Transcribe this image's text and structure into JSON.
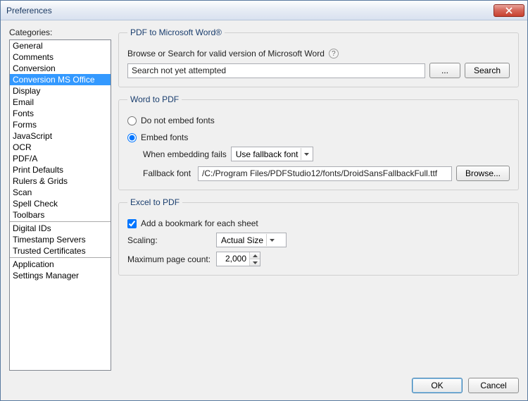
{
  "window": {
    "title": "Preferences"
  },
  "sidebar": {
    "label": "Categories:",
    "groups": [
      [
        "General",
        "Comments",
        "Conversion",
        "Conversion MS Office",
        "Display",
        "Email",
        "Fonts",
        "Forms",
        "JavaScript",
        "OCR",
        "PDF/A",
        "Print Defaults",
        "Rulers & Grids",
        "Scan",
        "Spell Check",
        "Toolbars"
      ],
      [
        "Digital IDs",
        "Timestamp Servers",
        "Trusted Certificates"
      ],
      [
        "Application",
        "Settings Manager"
      ]
    ],
    "selected": "Conversion MS Office"
  },
  "pdf_to_word": {
    "legend": "PDF to Microsoft Word®",
    "instruction": "Browse or Search for valid version of Microsoft Word",
    "status": "Search not yet attempted",
    "browse_label": "...",
    "search_label": "Search"
  },
  "word_to_pdf": {
    "legend": "Word to PDF",
    "opt_no_embed": "Do not embed fonts",
    "opt_embed": "Embed fonts",
    "embed_selected": true,
    "when_fails_label": "When embedding fails",
    "when_fails_value": "Use fallback font",
    "fallback_label": "Fallback font",
    "fallback_value": "/C:/Program Files/PDFStudio12/fonts/DroidSansFallbackFull.ttf",
    "browse_label": "Browse..."
  },
  "excel_to_pdf": {
    "legend": "Excel to PDF",
    "bookmark_label": "Add a bookmark for each sheet",
    "bookmark_checked": true,
    "scaling_label": "Scaling:",
    "scaling_value": "Actual Size",
    "max_page_label": "Maximum page count:",
    "max_page_value": "2,000"
  },
  "footer": {
    "ok": "OK",
    "cancel": "Cancel"
  }
}
